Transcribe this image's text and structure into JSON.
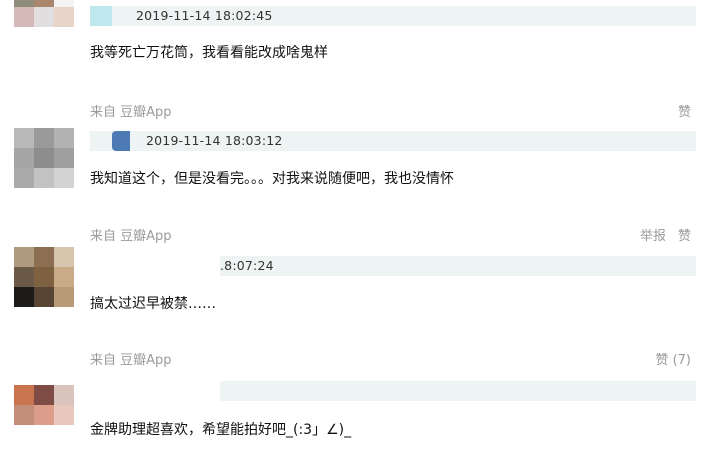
{
  "comments": [
    {
      "source": "",
      "actions": [],
      "quote_time": "2019-11-14 18:02:45",
      "text": "我等死亡万花筒，我看看能改成啥鬼样",
      "avatar_colors": [
        "#8e8d7c",
        "#a9876c",
        "#f4f2f2",
        "#d4b9b8",
        "#e2dedf",
        "#e9d4ca",
        "#ffffff",
        "#ffffff",
        "#ffffff"
      ],
      "quote_thumb_color": "#bfe8ee"
    },
    {
      "source": "来自 豆瓣App",
      "actions": [
        "赞"
      ],
      "quote_time": "2019-11-14 18:03:12",
      "text": "我知道这个，但是没看完。。。对我来说随便吧，我也没情怀",
      "avatar_colors": [
        "#b9b9b9",
        "#9a9a9a",
        "#b3b3b3",
        "#a6a6a6",
        "#8d8d8d",
        "#9f9f9f",
        "#aaaaaa",
        "#c2c2c2",
        "#d3d3d3"
      ],
      "quote_thumb_color": "#4d79b4"
    },
    {
      "source": "来自 豆瓣App",
      "actions": [
        "举报",
        "赞"
      ],
      "quote_time": ".8:07:24",
      "text": "搞太过迟早被禁……",
      "avatar_colors": [
        "#b09a80",
        "#8c6f52",
        "#d7c4ad",
        "#6b5a48",
        "#7d6141",
        "#c9ab87",
        "#1d1a17",
        "#574432",
        "#b99a78"
      ],
      "quote_thumb_color": "#ffffff"
    },
    {
      "source": "来自 豆瓣App",
      "actions": [
        "赞 (7)"
      ],
      "quote_time": "",
      "text": "金牌助理超喜欢，希望能拍好吧_(:3」∠)_",
      "avatar_colors": [
        "#c9734f",
        "#7e4b45",
        "#d9c3bd",
        "#c28e77",
        "#dc9e8a",
        "#e8c8bd",
        "#ffffff",
        "#ffffff",
        "#ffffff"
      ],
      "quote_thumb_color": "#ffffff"
    }
  ]
}
